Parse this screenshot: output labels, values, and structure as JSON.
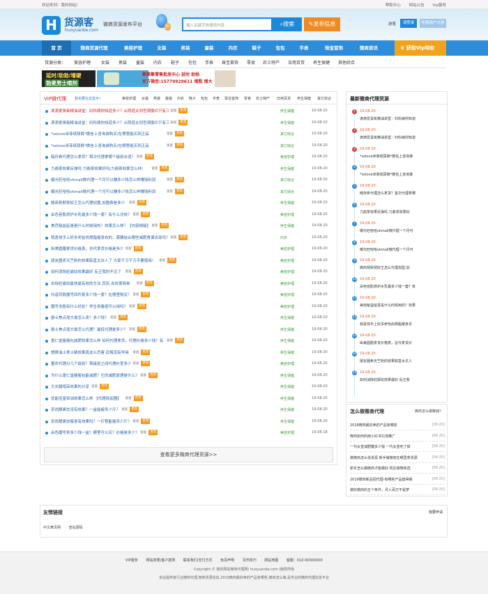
{
  "topbar": {
    "welcome": "欢迎来到：我的网站！",
    "links": [
      "帮助中心",
      "网站公告",
      "Vip服务"
    ]
  },
  "header": {
    "logo_mark": "H",
    "logo_cn": "货源客",
    "logo_en": "huoyuanke.com",
    "slogan": "微商货源发布平台",
    "search_placeholder": "输入关键字快速找内容",
    "search_button": "搜索",
    "publish_button": "发布信息",
    "guest_label": "游客",
    "login_button": "请登录",
    "register_button": "免费用户注册"
  },
  "nav": {
    "items": [
      "首 页",
      "微商货源代理",
      "美容护理",
      "女装",
      "男装",
      "童装",
      "内衣",
      "鞋子",
      "包包",
      "手表",
      "珠宝首饰",
      "微商资讯"
    ],
    "vip": "获取Vip特权"
  },
  "subnav": {
    "label": "货源分类：",
    "items": [
      "美容护理",
      "女装",
      "男装",
      "童装",
      "内衣",
      "鞋子",
      "包包",
      "手表",
      "珠宝首饰",
      "零食",
      "农土特产",
      "日用百货",
      "养生保健",
      "其他综合"
    ]
  },
  "banner": {
    "b1_line1": "延时/助勃/增硬",
    "b1_line2": "勃麦男士喷剂",
    "b3_line1": "聚聚聚零售批发中心 延时 助勃",
    "b3_line2": "官方微信:15779929611 增粗 增大"
  },
  "main": {
    "title": "VIP微代理",
    "tip": "我也要在这显示！",
    "categories": [
      "美容护理",
      "女装",
      "男装",
      "童装",
      "内衣",
      "鞋子",
      "包包",
      "手表",
      "珠宝首饰",
      "零食",
      "农土特产",
      "日用百货",
      "养生保健",
      "其它综合"
    ],
    "fu_label": "富富",
    "tag_label": "贵宾",
    "rows": [
      {
        "title": "滴滴爱臭氧精油讲堂：妇科病你知道多少？从阴道炎到宫颈糜烂只有三",
        "cat": "养生保健",
        "date": "19-08-20",
        "red": true
      },
      {
        "title": "滴滴爱臭氧精油讲堂：妇科病你知道多少？从阴道炎到宫颈糜烂只有三",
        "cat": "养生保健",
        "date": "19-08-20",
        "red": false
      },
      {
        "title": "*solove米菲纸尿裤*微信上咨询谁购买/在哪里能买到正品",
        "cat": "其它综合",
        "date": "19-08-20",
        "red": false
      },
      {
        "title": "*solove米菲纸尿裤*微信上咨询谁购买/在哪里能买到正品",
        "cat": "其它综合",
        "date": "19-08-20",
        "red": false
      },
      {
        "title": "暗存希代理怎么拿货？首次代理拿哪个级别合适？",
        "cat": "美容护理",
        "date": "19-08-20",
        "red": false
      },
      {
        "title": "力鼎茶效果反弹吗 力鼎茶效果好吗/力鼎茶效果怎么样/",
        "cat": "养生保健",
        "date": "19-08-20",
        "red": false
      },
      {
        "title": "曝光旺哈哈vkmall微代理一个月可以赚多少钱怎么样赚钱利润",
        "cat": "其它综合",
        "date": "19-08-20",
        "red": false
      },
      {
        "title": "曝光旺哈哈vkmall微代理一个月可以赚多少钱怎么样赚钱利润",
        "cat": "其它综合",
        "date": "19-08-20",
        "red": false
      },
      {
        "title": "微商契默契奴王怎么代理加盟,加盟费是多少",
        "cat": "养生保健",
        "date": "19-08-20",
        "red": false
      },
      {
        "title": "朵色容肌修护水乳霜多少钱一套？有什么功效？",
        "cat": "美容护理",
        "date": "19-08-20",
        "red": false
      },
      {
        "title": "美芭秘益延膏是什么时候用的？效果怎么样？【内容揭秘】",
        "cat": "养生保健",
        "date": "19-08-20",
        "red": false
      },
      {
        "title": "我喜快手上好多卖怡尚燃脂瘦身衣的，需要结合哪些减肥食谱去穿吗？",
        "cat": "内衣",
        "date": "19-08-20",
        "red": false
      },
      {
        "title": "纵美圆膳拿货价格表，总代拿货价格是多少",
        "cat": "美容护理",
        "date": "19-08-20",
        "red": false
      },
      {
        "title": "朋友圈卖天竺粉的效果踪直太坑人了 大家千万千万不要使用！",
        "cat": "美容护理",
        "date": "19-08-20",
        "red": false
      },
      {
        "title": "如何消除妊娠纹效果最好 反正我的不见了",
        "cat": "美容护理",
        "date": "19-08-20",
        "red": false
      },
      {
        "title": "去除妊娠纹最快最有效的方法 其实,去纹很简单",
        "cat": "美容护理",
        "date": "19-08-20",
        "red": false
      },
      {
        "title": "抖音同款魔号四件套多少钱一套？在哪里购买？",
        "cat": "美容护理",
        "date": "19-08-20",
        "red": false
      },
      {
        "title": "魔号洗脸有什么好处？学生青春痘可以用吗？",
        "cat": "美容护理",
        "date": "19-08-20",
        "red": false
      },
      {
        "title": "爵士焦点增大膏怎么卖？多少钱？",
        "cat": "养生保健",
        "date": "19-08-20",
        "red": false
      },
      {
        "title": "爵士焦点增大膏怎么代理？最低代理是多少？",
        "cat": "养生保健",
        "date": "19-08-20",
        "red": false
      },
      {
        "title": "香仁堂瘦瘦包减肥效果怎么样 如何代理拿货，代理价格多少钱？有",
        "cat": "养生保健",
        "date": "19-08-20",
        "red": false
      },
      {
        "title": "想擦油士男士精效果真这么厉害 后悔没有早用",
        "cat": "养生保健",
        "date": "19-08-20",
        "red": false
      },
      {
        "title": "董欢代理分几个级别？首级别之间代理价差多少",
        "cat": "美容护理",
        "date": "19-08-20",
        "red": false
      },
      {
        "title": "为什么香仁堂瘦瘦包能减肥？它的减肥原理是什么？",
        "cat": "养生保健",
        "date": "19-08-20",
        "red": false
      },
      {
        "title": "大长腿增高效果的分享",
        "cat": "养生保健",
        "date": "19-08-20",
        "red": false
      },
      {
        "title": "优能佳皇帝油效果怎么样 【代理商加盟】",
        "cat": "养生保健",
        "date": "19-08-20",
        "red": false
      },
      {
        "title": "奈尚酵素饮没有效果？一盒能瘦多少斤？",
        "cat": "养生保健",
        "date": "19-08-20",
        "red": false
      },
      {
        "title": "奈尚酵素饮瘦身有效果吗？一疗程能瘦多少斤？",
        "cat": "养生保健",
        "date": "19-08-20",
        "red": false
      },
      {
        "title": "朵色魔号卖多少钱一盒？哪里可以买？价格是多少？",
        "cat": "美容护理",
        "date": "19-08-18",
        "red": false
      }
    ],
    "more": "查看更多微商代理货源>>"
  },
  "side": {
    "title": "最新微商代理货源",
    "items": [
      {
        "n": "1",
        "date": "19-08-20",
        "text": "滴滴爱臭氧精油讲堂：妇科病你知道",
        "red": true
      },
      {
        "n": "2",
        "date": "19-08-20",
        "text": "滴滴爱臭氧精油讲堂：妇科病你知道",
        "red": true
      },
      {
        "n": "3",
        "date": "19-08-20",
        "text": "*solove米菲纸尿裤*微信上咨询谁",
        "red": true
      },
      {
        "n": "4",
        "date": "19-08-20",
        "text": "*solove米菲纸尿裤*微信上咨询谁",
        "red": false
      },
      {
        "n": "5",
        "date": "19-08-20",
        "text": "暗存希代理怎么拿货？首次代理拿哪",
        "red": false
      },
      {
        "n": "6",
        "date": "19-08-20",
        "text": "力鼎茶效果反弹吗 力鼎茶效果好",
        "red": false
      },
      {
        "n": "7",
        "date": "19-08-20",
        "text": "曝光旺哈哈vkmall微代理一个月可",
        "red": false
      },
      {
        "n": "8",
        "date": "19-08-20",
        "text": "曝光旺哈哈vkmall微代理一个月可",
        "red": false
      },
      {
        "n": "9",
        "date": "19-08-20",
        "text": "微商契默契奴王怎么代理加盟,加",
        "red": false
      },
      {
        "n": "10",
        "date": "19-08-20",
        "text": "朵色容肌修护水乳霜多少钱一套？有",
        "red": false
      },
      {
        "n": "11",
        "date": "19-08-20",
        "text": "美芭秘益延膏是什么时候用的？效果",
        "red": false
      },
      {
        "n": "12",
        "date": "19-08-20",
        "text": "我喜快手上好多卖怡尚燃脂瘦身衣",
        "red": false
      },
      {
        "n": "13",
        "date": "19-08-20",
        "text": "纵美圆膳拿货价格表，总代拿货价",
        "red": false
      },
      {
        "n": "14",
        "date": "19-08-20",
        "text": "朋友圈卖天竺粉的效果踪直太坑人",
        "red": false
      },
      {
        "n": "15",
        "date": "19-08-20",
        "text": "如何消除妊娠纹效果最好 反正我",
        "red": false
      }
    ]
  },
  "side2": {
    "title": "怎么做微商代理",
    "more": "微商怎么做赚钱？",
    "items": [
      {
        "text": "2018微商最好卖的产品有哪些",
        "date": "[08-20]"
      },
      {
        "text": "微商如何利用小红书引流推广",
        "date": "[08-20]"
      },
      {
        "text": "一代女皇减肥糖多少钱 一代女皇吃了掉",
        "date": "[08-20]"
      },
      {
        "text": "做微商怎么找货源 新手做微商在哪里拿货源",
        "date": "[08-20]"
      },
      {
        "text": "新手怎么做微商才能做好 现在做微商选",
        "date": "[08-20]"
      },
      {
        "text": "2019微商新品招代理-有哪些产品值得做",
        "date": "[08-20]"
      },
      {
        "text": "做好微商的五个条件，月入百万不是梦",
        "date": "[08-20]"
      }
    ]
  },
  "friends": {
    "title": "友情链接",
    "apply": "我要申请",
    "links": [
      "中文黄页网",
      "查站源码"
    ]
  },
  "footer": {
    "links": [
      "VIP服务",
      "网站效果/客户案例",
      "联系我们/支付方式",
      "免责声明",
      "写作技巧",
      "网站地图",
      "客服：010-00000000"
    ],
    "copyright": "Copyright © 我的网站微商代理网( huoyuanke.com )版权所有",
    "desc": "本站提供各行业微商代理,微商货源信息,2019微商最好卖的产品有哪些,微商怎么做,是专业的微商代理信息平台"
  }
}
